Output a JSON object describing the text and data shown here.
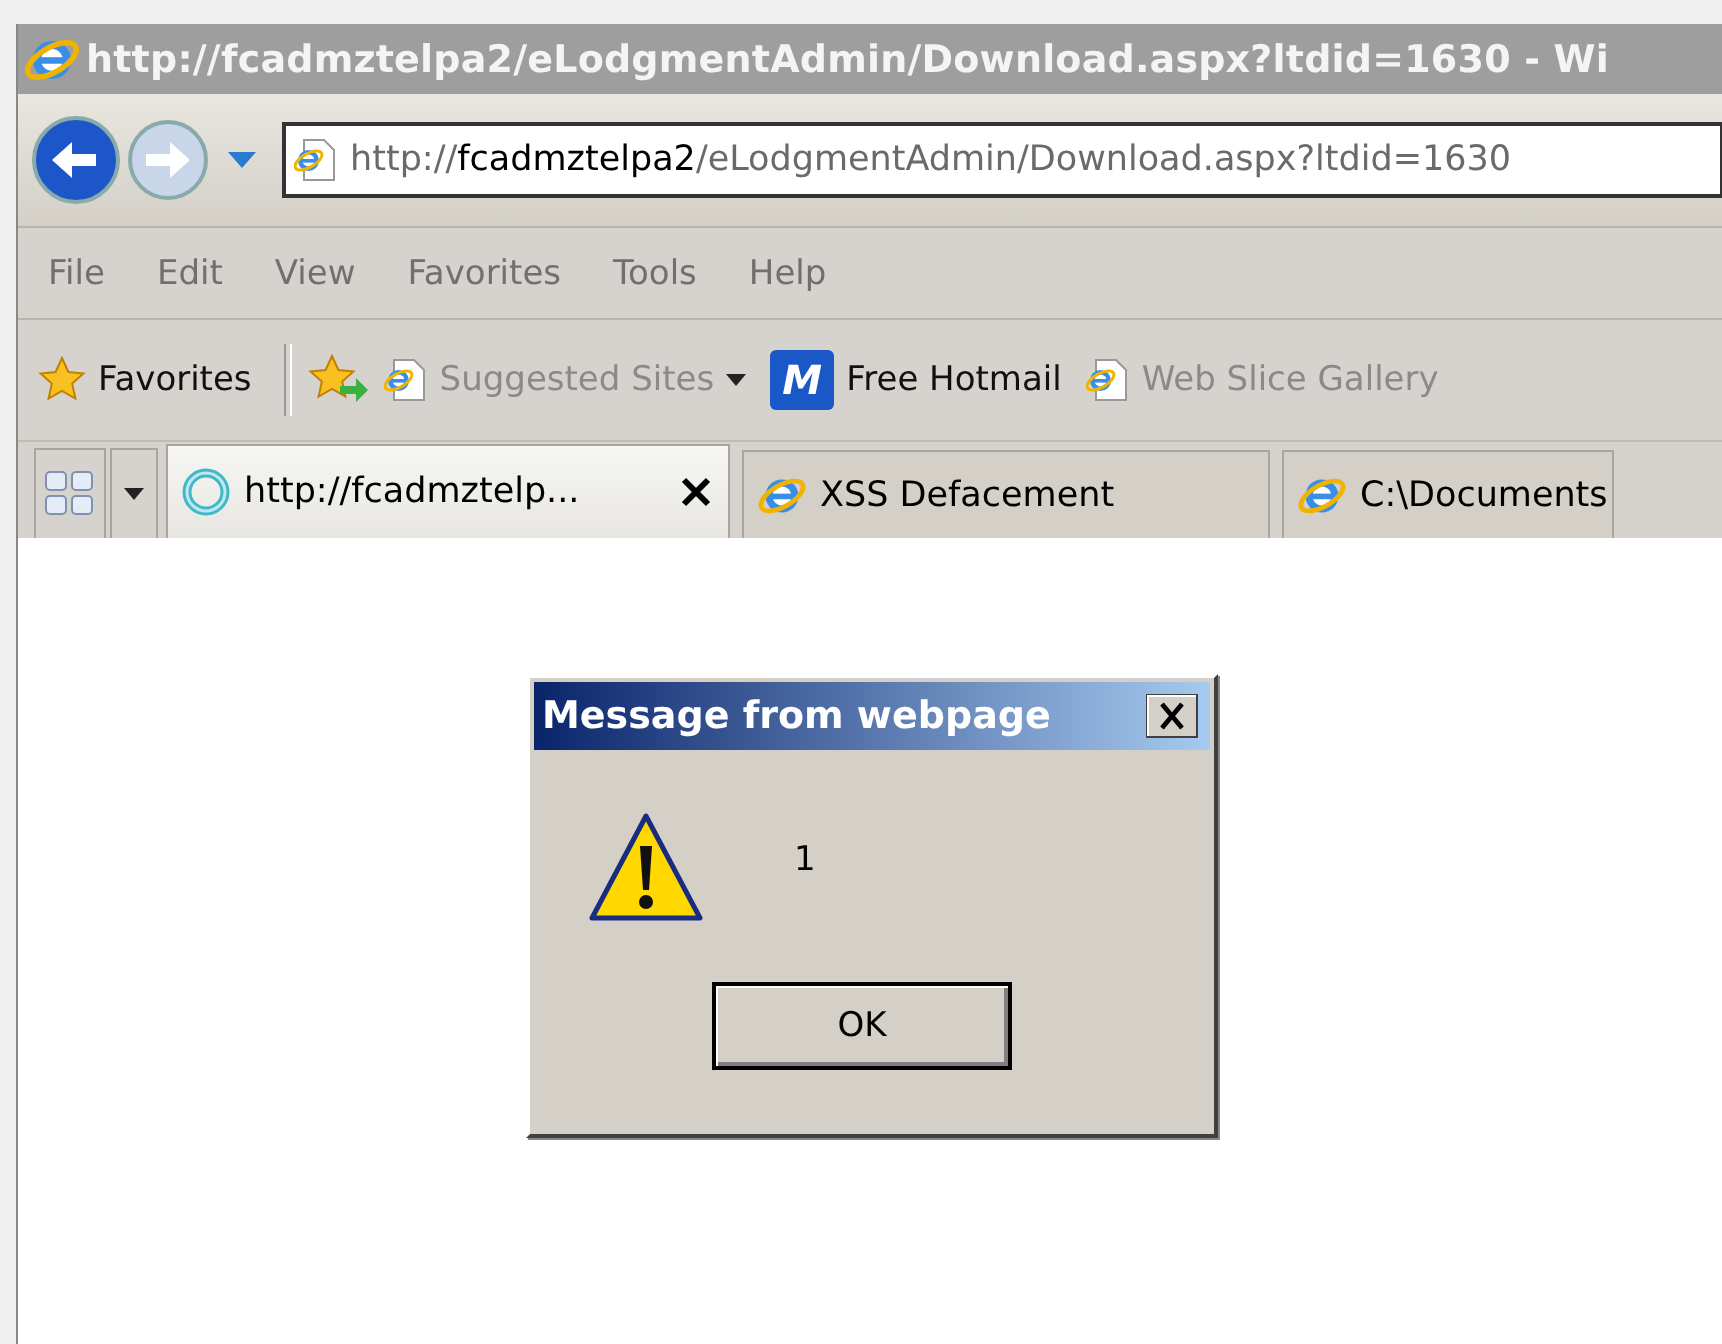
{
  "window": {
    "title": "http://fcadmztelpa2/eLodgmentAdmin/Download.aspx?ltdid=1630 - Wi"
  },
  "address": {
    "scheme": "http://",
    "host": "fcadmztelpa2",
    "path": "/eLodgmentAdmin/Download.aspx?ltdid=1630"
  },
  "menu": [
    "File",
    "Edit",
    "View",
    "Favorites",
    "Tools",
    "Help"
  ],
  "favorites_bar": {
    "label": "Favorites",
    "links": [
      {
        "kind": "ie",
        "label": "Suggested Sites",
        "disabled": true,
        "dropdown": true
      },
      {
        "kind": "hotmail",
        "label": "Free Hotmail",
        "logo": "M",
        "disabled": false,
        "dropdown": false
      },
      {
        "kind": "ie",
        "label": "Web Slice Gallery",
        "disabled": true,
        "dropdown": false
      }
    ]
  },
  "tabs": [
    {
      "label": "http://fcadmztelp...",
      "selected": true,
      "loading": true,
      "closable": true
    },
    {
      "label": "XSS Defacement",
      "selected": false,
      "loading": false,
      "closable": false
    },
    {
      "label": "C:\\Documents",
      "selected": false,
      "loading": false,
      "closable": false
    }
  ],
  "dialog": {
    "title": "Message from webpage",
    "message": "1",
    "buttons": [
      "OK"
    ]
  }
}
